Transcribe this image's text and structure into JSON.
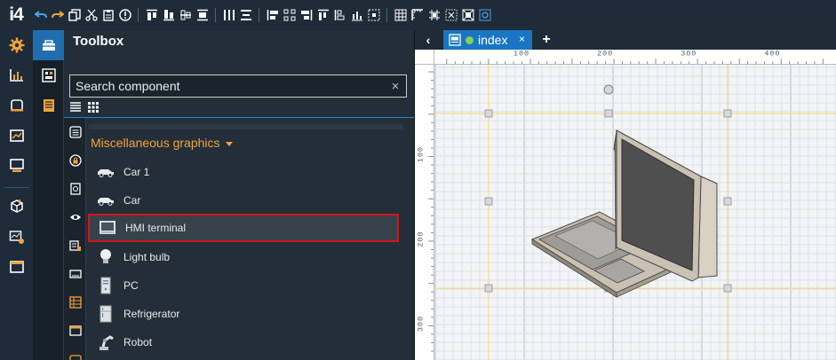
{
  "app": {
    "logo": "i4"
  },
  "toolbox": {
    "title": "Toolbox",
    "search": {
      "placeholder": "Search component",
      "value": "",
      "clear": "×"
    },
    "category": {
      "title": "Miscellaneous graphics"
    },
    "items": [
      {
        "label": "Car 1",
        "icon": "car-icon"
      },
      {
        "label": "Car",
        "icon": "car-icon"
      },
      {
        "label": "HMI terminal",
        "icon": "hmi-terminal-icon",
        "selected": true
      },
      {
        "label": "Light bulb",
        "icon": "light-bulb-icon"
      },
      {
        "label": "PC",
        "icon": "pc-icon"
      },
      {
        "label": "Refrigerator",
        "icon": "refrigerator-icon"
      },
      {
        "label": "Robot",
        "icon": "robot-icon"
      }
    ]
  },
  "editor": {
    "tabs": [
      {
        "label": "index",
        "close": "×"
      }
    ],
    "add_tab": "+",
    "back": "‹",
    "ruler": {
      "top_labels": [
        "100",
        "200",
        "300",
        "400"
      ],
      "left_labels": [
        "100",
        "200",
        "300"
      ]
    }
  },
  "colors": {
    "accent": "#1976c4",
    "category": "#f0a33a",
    "selection": "#d0161c",
    "guide": "#f5d76e"
  }
}
